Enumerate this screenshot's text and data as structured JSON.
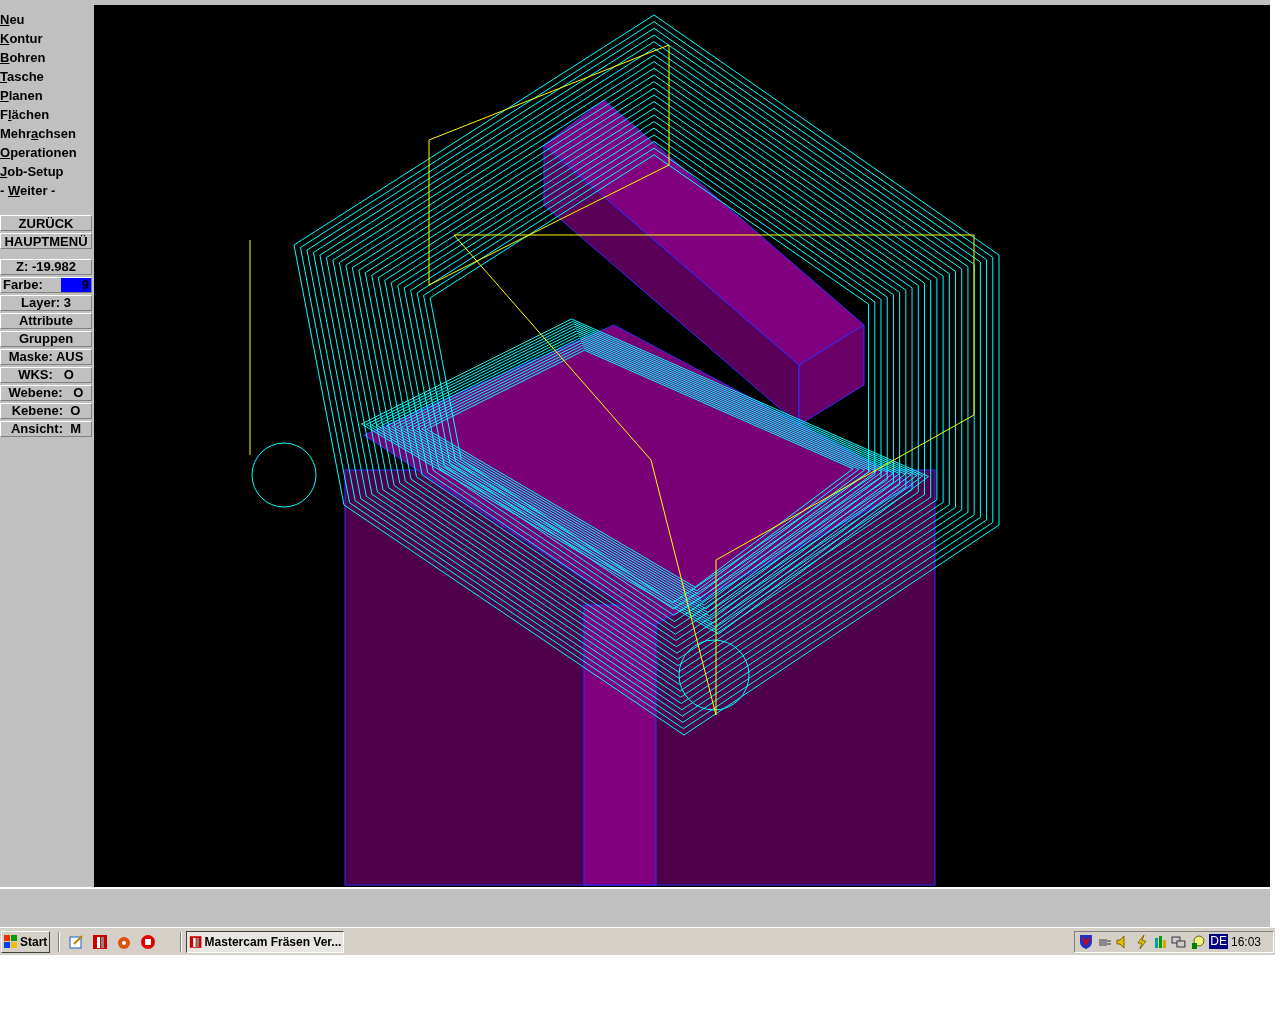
{
  "menu": [
    {
      "key": "N",
      "after": "eu"
    },
    {
      "key": "K",
      "after": "ontur"
    },
    {
      "key": "B",
      "after": "ohren"
    },
    {
      "key": "T",
      "after": "asche"
    },
    {
      "key": "P",
      "after": "lanen"
    },
    {
      "before": "F",
      "key": "l",
      "after": "ächen"
    },
    {
      "before": "Mehr",
      "key": "a",
      "after": "chsen"
    },
    {
      "key": "O",
      "after": "perationen"
    },
    {
      "key": "J",
      "after": "ob-Setup"
    },
    {
      "before": "- ",
      "key": "W",
      "after": "eiter -"
    }
  ],
  "nav_buttons": [
    "ZURÜCK",
    "HAUPTMENÜ"
  ],
  "status_items": [
    {
      "kind": "text",
      "label": "Z: -19.982"
    },
    {
      "kind": "swatch",
      "label": "Farbe:",
      "value": "9",
      "color": "#0000ff"
    },
    {
      "kind": "text",
      "label": "Layer: 3"
    },
    {
      "kind": "text",
      "label": "Attribute"
    },
    {
      "kind": "text",
      "label": "Gruppen"
    },
    {
      "kind": "text",
      "label": "Maske: AUS"
    },
    {
      "kind": "text",
      "label": "WKS:   O"
    },
    {
      "kind": "text",
      "label": "Webene:   O"
    },
    {
      "kind": "text",
      "label": "Kebene:  O"
    },
    {
      "kind": "text",
      "label": "Ansicht:  M"
    }
  ],
  "taskbar": {
    "start": "Start",
    "task": "Mastercam Fräsen Ver...",
    "tray_lang": "DE",
    "clock": "16:03"
  }
}
